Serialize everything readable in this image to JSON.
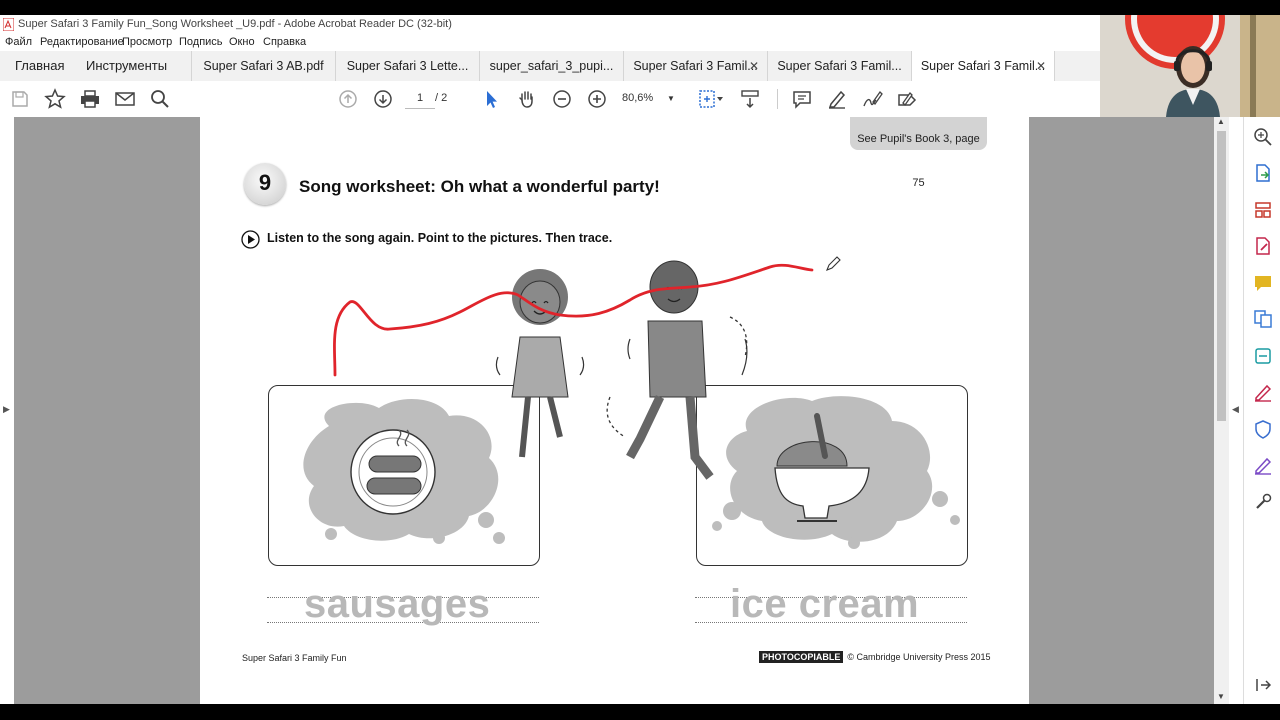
{
  "window": {
    "title": "Super Safari 3 Family Fun_Song Worksheet _U9.pdf - Adobe Acrobat Reader DC (32-bit)"
  },
  "menu": [
    "Файл",
    "Редактирование",
    "Просмотр",
    "Подпись",
    "Окно",
    "Справка"
  ],
  "tabs": {
    "home": "Главная",
    "tools": "Инструменты",
    "documents": [
      {
        "label": "Super Safari 3 AB.pdf",
        "active": false,
        "closable": false
      },
      {
        "label": "Super Safari 3 Lette...",
        "active": false,
        "closable": false
      },
      {
        "label": "super_safari_3_pupi...",
        "active": false,
        "closable": false
      },
      {
        "label": "Super Safari 3 Famil...",
        "active": false,
        "closable": true
      },
      {
        "label": "Super Safari 3 Famil...",
        "active": false,
        "closable": false
      },
      {
        "label": "Super Safari 3 Famil...",
        "active": true,
        "closable": true
      }
    ]
  },
  "toolbar": {
    "current_page": "1",
    "total_pages": "/ 2",
    "zoom": "80,6%"
  },
  "worksheet": {
    "see_pupils_book": "See Pupil's Book 3, page 75",
    "exercise_number": "9",
    "title": "Song worksheet: Oh what a wonderful party!",
    "instruction": "Listen to the song again. Point to the pictures. Then trace.",
    "word_left": "sausages",
    "word_right": "ice cream",
    "footer_left": "Super Safari 3 Family Fun",
    "photocopiable": "PHOTOCOPIABLE",
    "copyright": "© Cambridge University Press 2015"
  },
  "colors": {
    "annotation_line": "#e0242b",
    "viewer_bg": "#9c9c9c",
    "active_tab": "#ffffff",
    "tab_bar": "#f1f1f1",
    "right_panel_icons": [
      "#2f6fd1",
      "#2e9c4a",
      "#c6382c",
      "#e2b522",
      "#3a7bd5",
      "#1a9ba2",
      "#c4274c",
      "#3a6fcf",
      "#7b4bc6",
      "#444444"
    ]
  }
}
